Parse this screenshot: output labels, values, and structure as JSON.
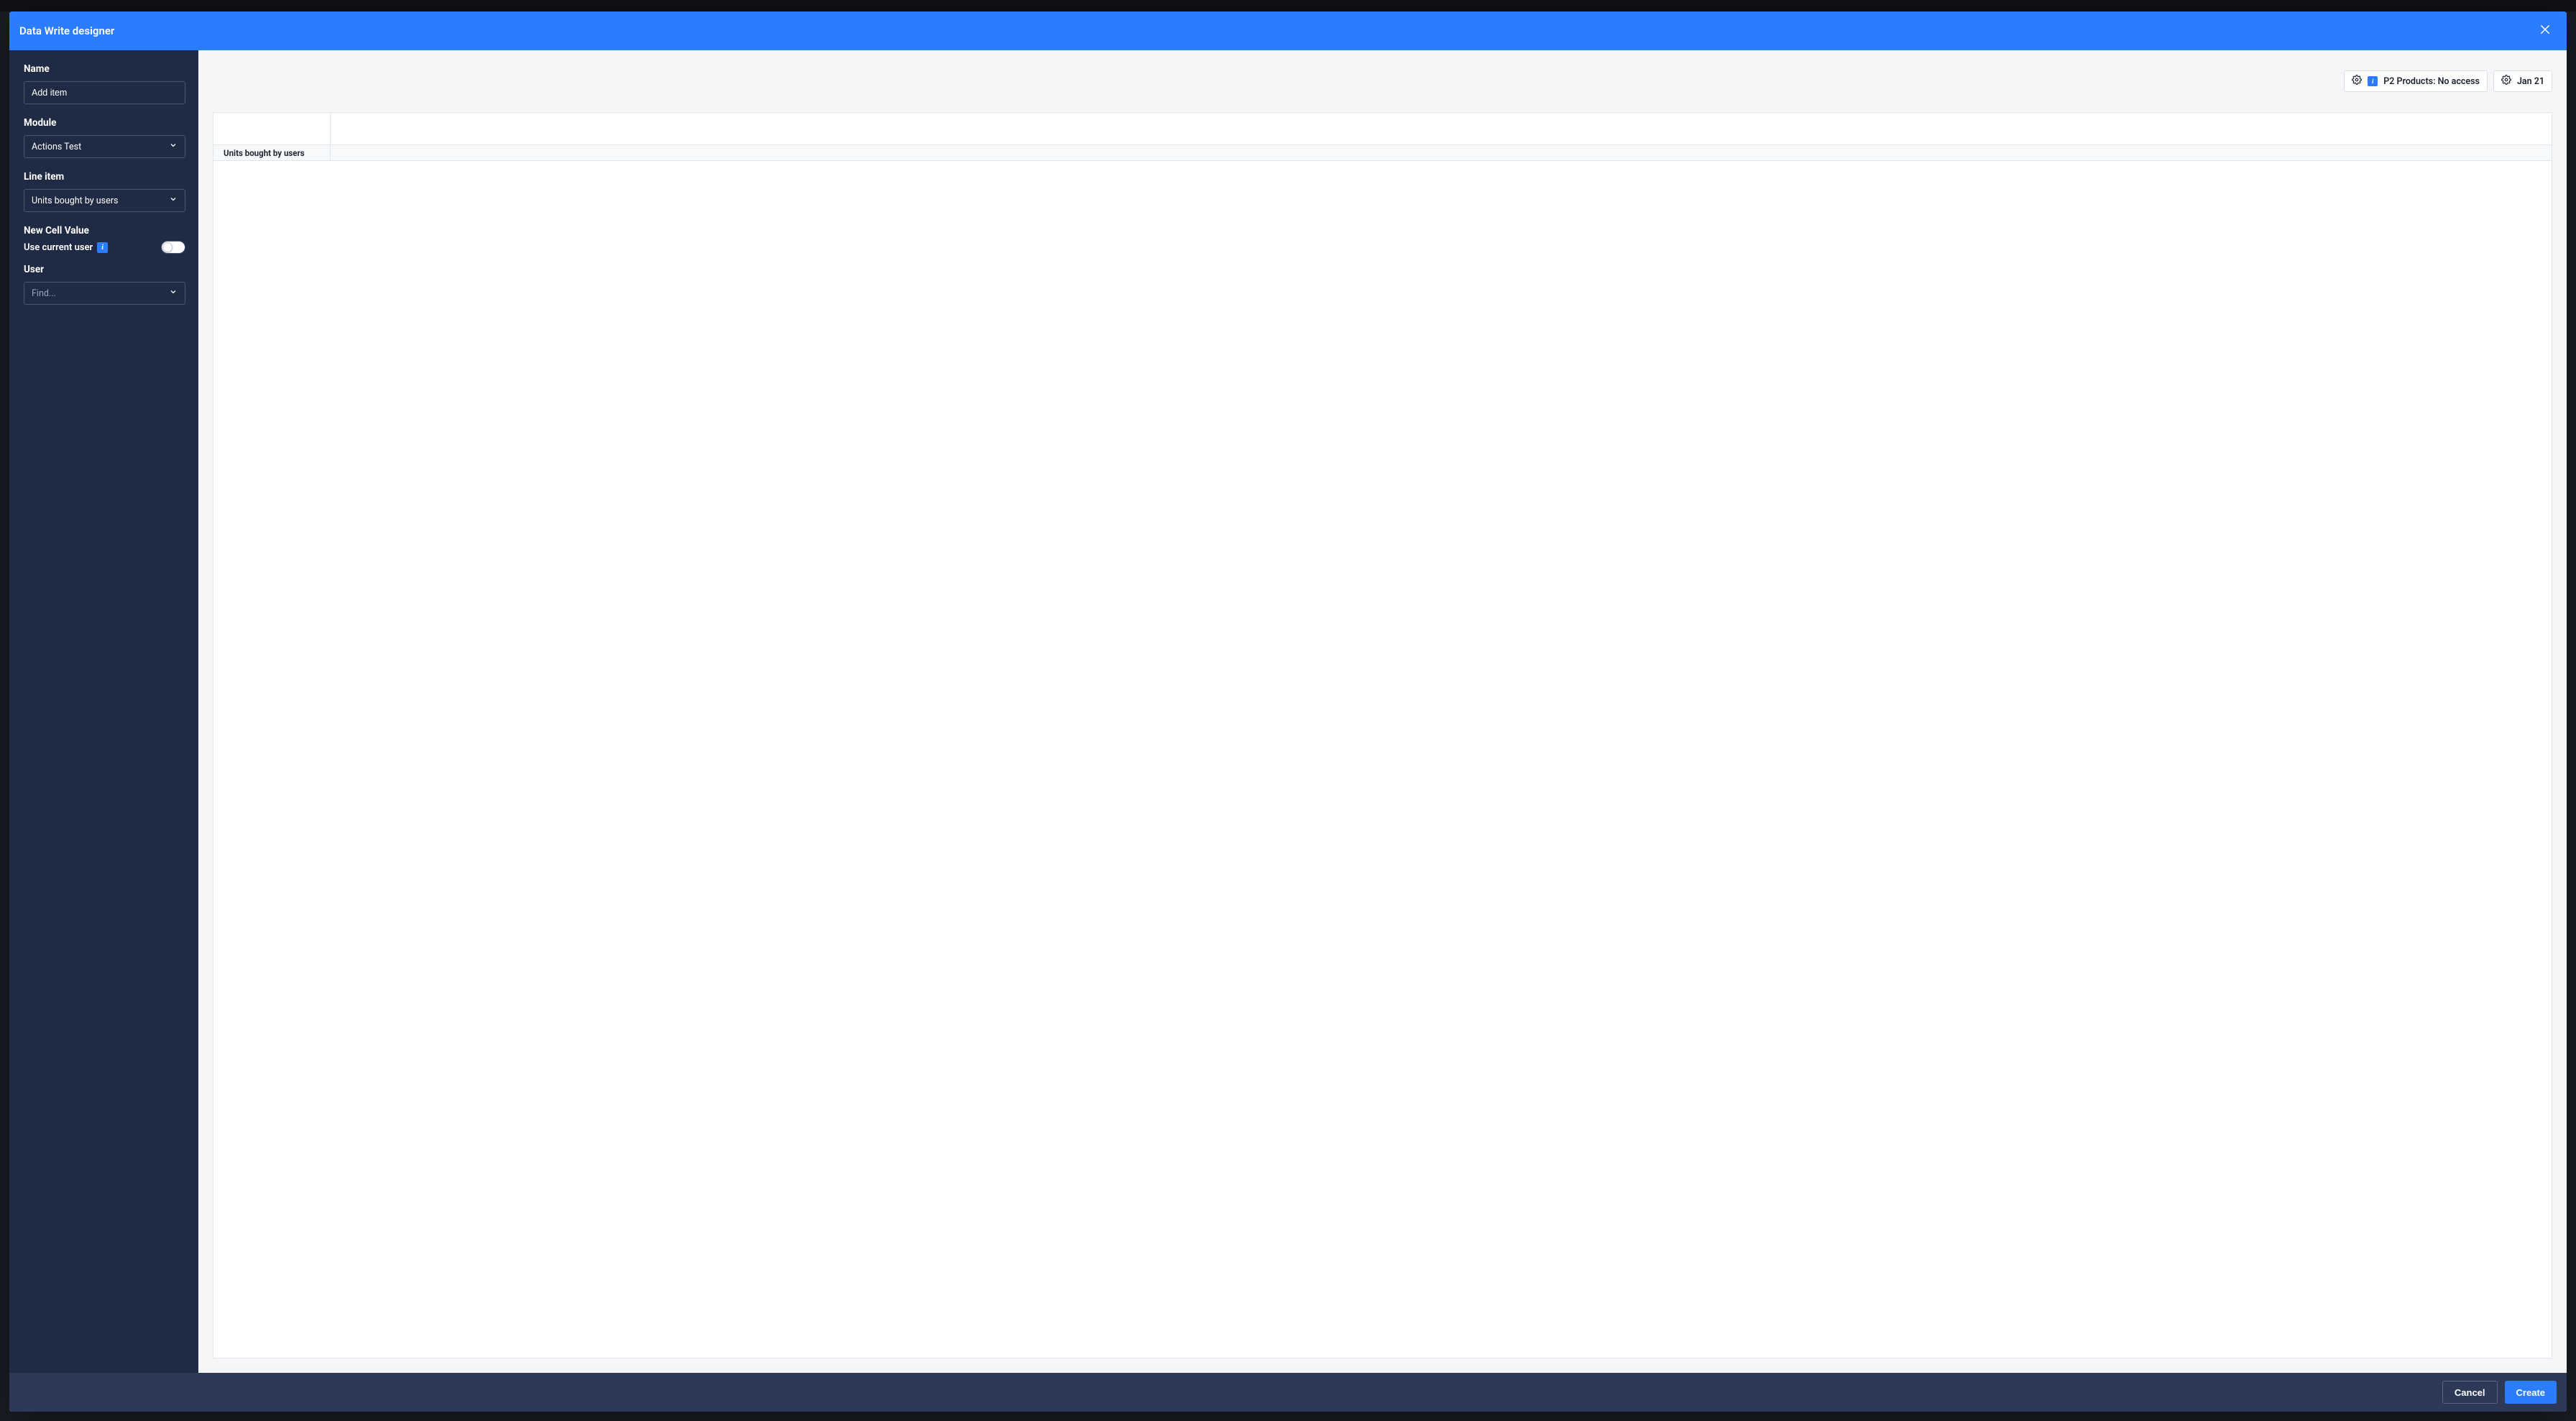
{
  "modal": {
    "title": "Data Write designer"
  },
  "sidebar": {
    "name": {
      "label": "Name",
      "value": "Add item"
    },
    "module": {
      "label": "Module",
      "value": "Actions Test"
    },
    "line_item": {
      "label": "Line item",
      "value": "Units bought by users"
    },
    "new_cell_value": {
      "label": "New Cell Value"
    },
    "use_current_user": {
      "label": "Use current user",
      "value": false
    },
    "user": {
      "label": "User",
      "placeholder": "Find..."
    }
  },
  "toolbar": {
    "products_chip": "P2 Products: No access",
    "date_chip": "Jan 21"
  },
  "grid": {
    "row_header": "Units bought by users"
  },
  "footer": {
    "cancel": "Cancel",
    "create": "Create"
  }
}
